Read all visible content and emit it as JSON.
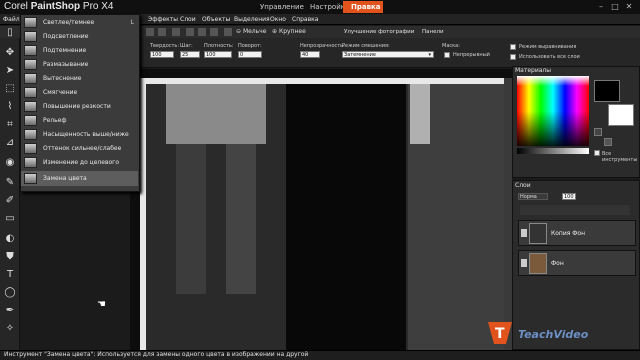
{
  "window": {
    "title_light": "Corel ",
    "title_bold": "PaintShop",
    "title_tail": " Pro X4",
    "tabs": [
      "Управление",
      "Настройка",
      "Правка"
    ],
    "active_tab": "Правка"
  },
  "menubar": {
    "items": [
      "Файл",
      "Эффекты",
      "Слои",
      "Объекты",
      "Выделения",
      "Окно",
      "Справка"
    ]
  },
  "toolbar": {
    "zoom_out_label": "Мельче",
    "zoom_in_label": "Крупнее",
    "enhance_label": "Улучшение фотографии",
    "panels_label": "Панели"
  },
  "options": {
    "hardness_label": "Твердость:",
    "hardness_value": "100",
    "step_label": "Шаг:",
    "step_value": "25",
    "density_label": "Плотность:",
    "density_value": "100",
    "rotation_label": "Поворот:",
    "rotation_value": "0",
    "opacity_label": "Непрозрачность:",
    "opacity_value": "40",
    "blend_label": "Режим смешения:",
    "blend_value": "Затемнение",
    "mask_label": "Маска:",
    "continuous_label": "Непрерывный",
    "smoothing_label": "Режим выравнивания",
    "all_layers_label": "Использовать все слои"
  },
  "dropdown": {
    "items": [
      {
        "label": "Светлее/темнее",
        "key": "L"
      },
      {
        "label": "Подсветление",
        "key": ""
      },
      {
        "label": "Подтемнение",
        "key": ""
      },
      {
        "label": "Размазывание",
        "key": ""
      },
      {
        "label": "Вытеснение",
        "key": ""
      },
      {
        "label": "Смягчение",
        "key": ""
      },
      {
        "label": "Повышение резкости",
        "key": ""
      },
      {
        "label": "Рельеф",
        "key": ""
      },
      {
        "label": "Насыщенность выше/ниже",
        "key": ""
      },
      {
        "label": "Оттенок сильнее/слабее",
        "key": ""
      },
      {
        "label": "Изменение до целевого",
        "key": ""
      },
      {
        "label": "Замена цвета",
        "key": ""
      }
    ],
    "active_index": 11
  },
  "materials": {
    "title": "Материалы",
    "all_tools_label": "Все инструменты"
  },
  "layers": {
    "title": "Слои",
    "blend_mode": "Норма",
    "opacity": "100",
    "rows": [
      {
        "name": "Копия Фон"
      },
      {
        "name": "Фон"
      }
    ]
  },
  "statusbar": {
    "text": "Инструмент \"Замена цвета\": Используется для замены одного цвета в изображении на другой"
  },
  "watermark": {
    "text": "TeachVideo"
  },
  "colors": {
    "accent": "#e0531c",
    "background": "#1b1b1b",
    "panel": "#2b2b2b"
  }
}
